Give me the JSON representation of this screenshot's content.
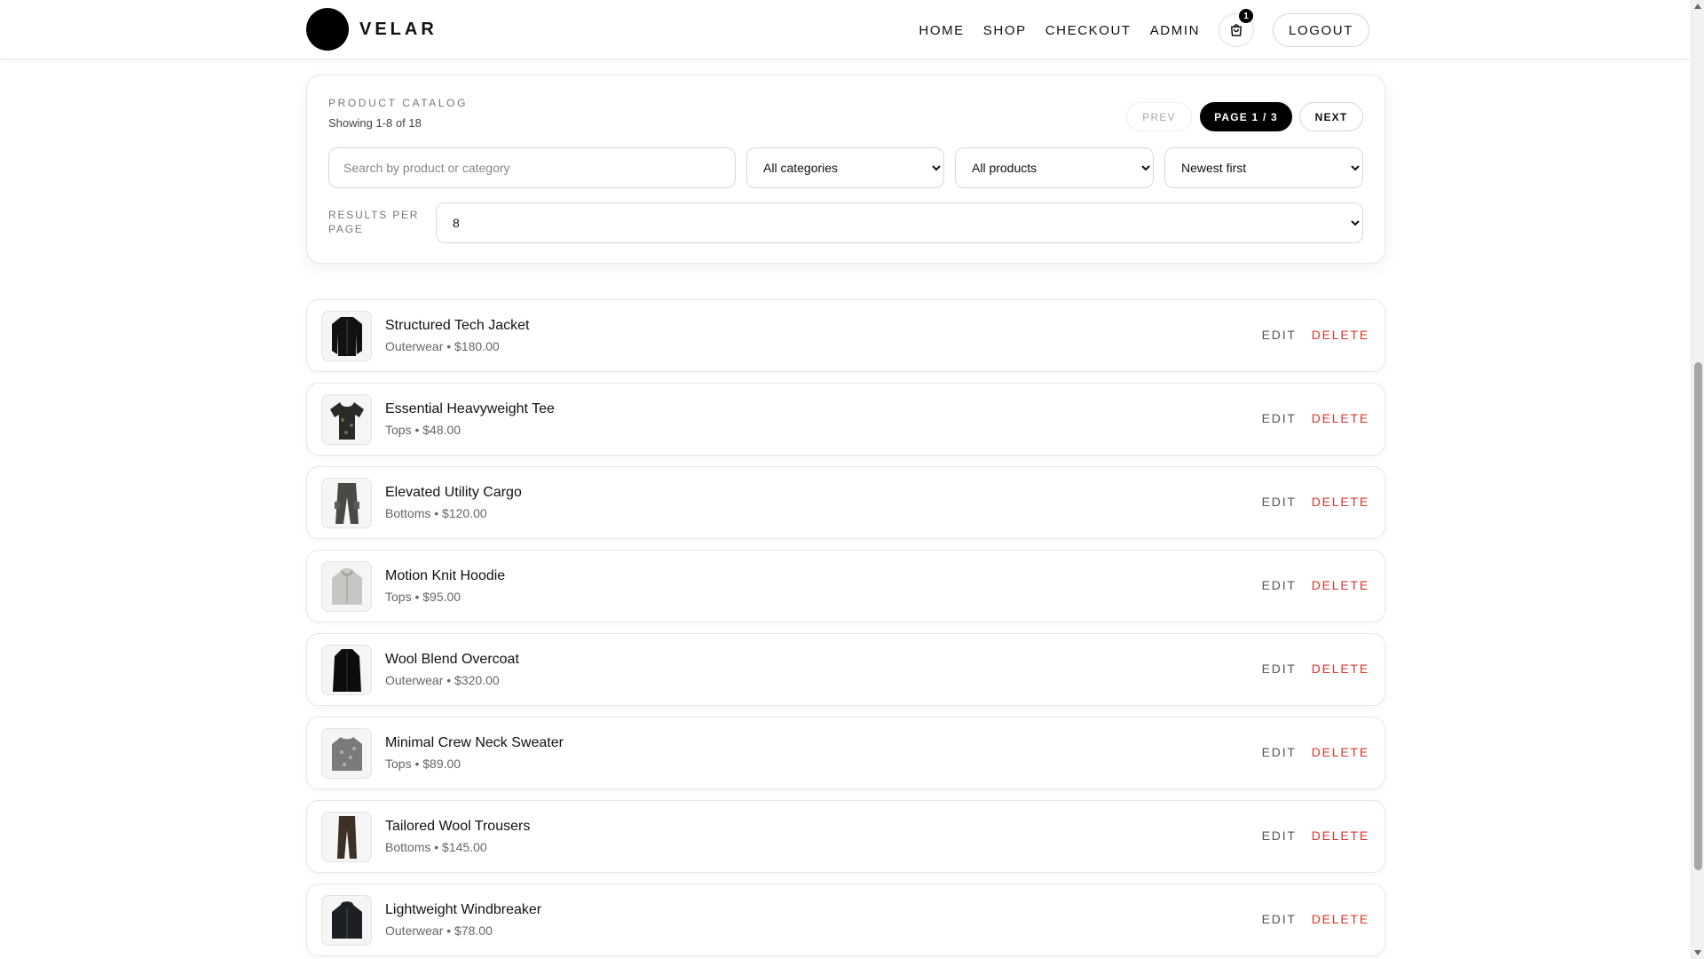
{
  "header": {
    "brand": "VELAR",
    "nav": [
      "HOME",
      "SHOP",
      "CHECKOUT",
      "ADMIN"
    ],
    "cart_count": "1",
    "logout_label": "LOGOUT"
  },
  "catalog": {
    "title": "PRODUCT CATALOG",
    "showing": "Showing 1-8 of 18",
    "pager": {
      "prev": "PREV",
      "page": "PAGE 1 / 3",
      "next": "NEXT"
    },
    "search_placeholder": "Search by product or category",
    "category_select": "All categories",
    "product_select": "All products",
    "sort_select": "Newest first",
    "results_per_page_label": "RESULTS PER PAGE",
    "results_per_page_value": "8"
  },
  "products": [
    {
      "name": "Structured Tech Jacket",
      "meta": "Outerwear • $180.00",
      "icon": "jacket-icon",
      "color": "#111111"
    },
    {
      "name": "Essential Heavyweight Tee",
      "meta": "Tops • $48.00",
      "icon": "tshirt-icon",
      "color": "#2a2a26"
    },
    {
      "name": "Elevated Utility Cargo",
      "meta": "Bottoms • $120.00",
      "icon": "trousers-icon",
      "color": "#4a4a44"
    },
    {
      "name": "Motion Knit Hoodie",
      "meta": "Tops • $95.00",
      "icon": "hoodie-icon",
      "color": "#c8c6c2"
    },
    {
      "name": "Wool Blend Overcoat",
      "meta": "Outerwear • $320.00",
      "icon": "coat-icon",
      "color": "#0c0c0c"
    },
    {
      "name": "Minimal Crew Neck Sweater",
      "meta": "Tops • $89.00",
      "icon": "sweater-icon",
      "color": "#7a7a7a"
    },
    {
      "name": "Tailored Wool Trousers",
      "meta": "Bottoms • $145.00",
      "icon": "trousers-icon",
      "color": "#3d3027"
    },
    {
      "name": "Lightweight Windbreaker",
      "meta": "Outerwear • $78.00",
      "icon": "windbreaker-icon",
      "color": "#1c1f24"
    }
  ],
  "actions": {
    "edit": "EDIT",
    "delete": "DELETE"
  }
}
